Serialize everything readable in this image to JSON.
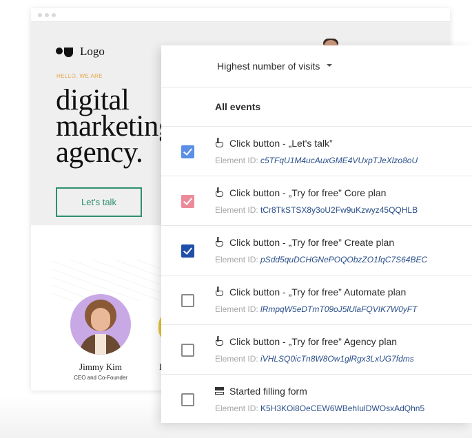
{
  "website": {
    "logo_text": "Logo",
    "eyebrow": "HELLO, WE ARE",
    "headline": "digital\nmarketing\nagency.",
    "cta_label": "Let's talk",
    "person": {
      "name": "Jimmy Kim",
      "role": "CEO and Co-Founder"
    },
    "person2_initial": "I"
  },
  "panel": {
    "sort_label": "Highest number of visits",
    "all_events_label": "All events",
    "id_label": "Element ID:",
    "events": [
      {
        "icon": "hand-pointer-icon",
        "title": "Click button - „Let's talk”",
        "element_id": "c5TFqU1M4ucAuxGME4VUxpTJeXlzo8oU",
        "checked": true,
        "check_color": "#5b8fe6",
        "id_italic": true
      },
      {
        "icon": "hand-pointer-icon",
        "title": "Click button - „Try for free” Core plan",
        "element_id": "tCr8TkSTSX8y3oU2Fw9uKzwyz45QQHLB",
        "checked": true,
        "check_color": "#ec8a9a",
        "id_italic": false
      },
      {
        "icon": "hand-pointer-icon",
        "title": "Click button - „Try for free” Create plan",
        "element_id": "pSdd5quDCHGNePOQObzZO1fqC7S64BEC",
        "checked": true,
        "check_color": "#1f4fa8",
        "id_italic": true
      },
      {
        "icon": "hand-pointer-icon",
        "title": "Click button - „Try for free” Automate plan",
        "element_id": "lRmpqW5eDTmT09oJ5lUlaFQVIK7W0yFT",
        "checked": false,
        "check_color": "",
        "id_italic": true
      },
      {
        "icon": "hand-pointer-icon",
        "title": "Click button - „Try for free” Agency plan",
        "element_id": "iVHLSQ0icTn8W8Ow1glRgx3LxUG7fdms",
        "checked": false,
        "check_color": "",
        "id_italic": true
      },
      {
        "icon": "form-icon",
        "title": "Started filling form",
        "element_id": "K5H3KOi8OeCEW6WBehIulDWOsxAdQhn5",
        "checked": false,
        "check_color": "",
        "id_italic": false
      }
    ]
  }
}
